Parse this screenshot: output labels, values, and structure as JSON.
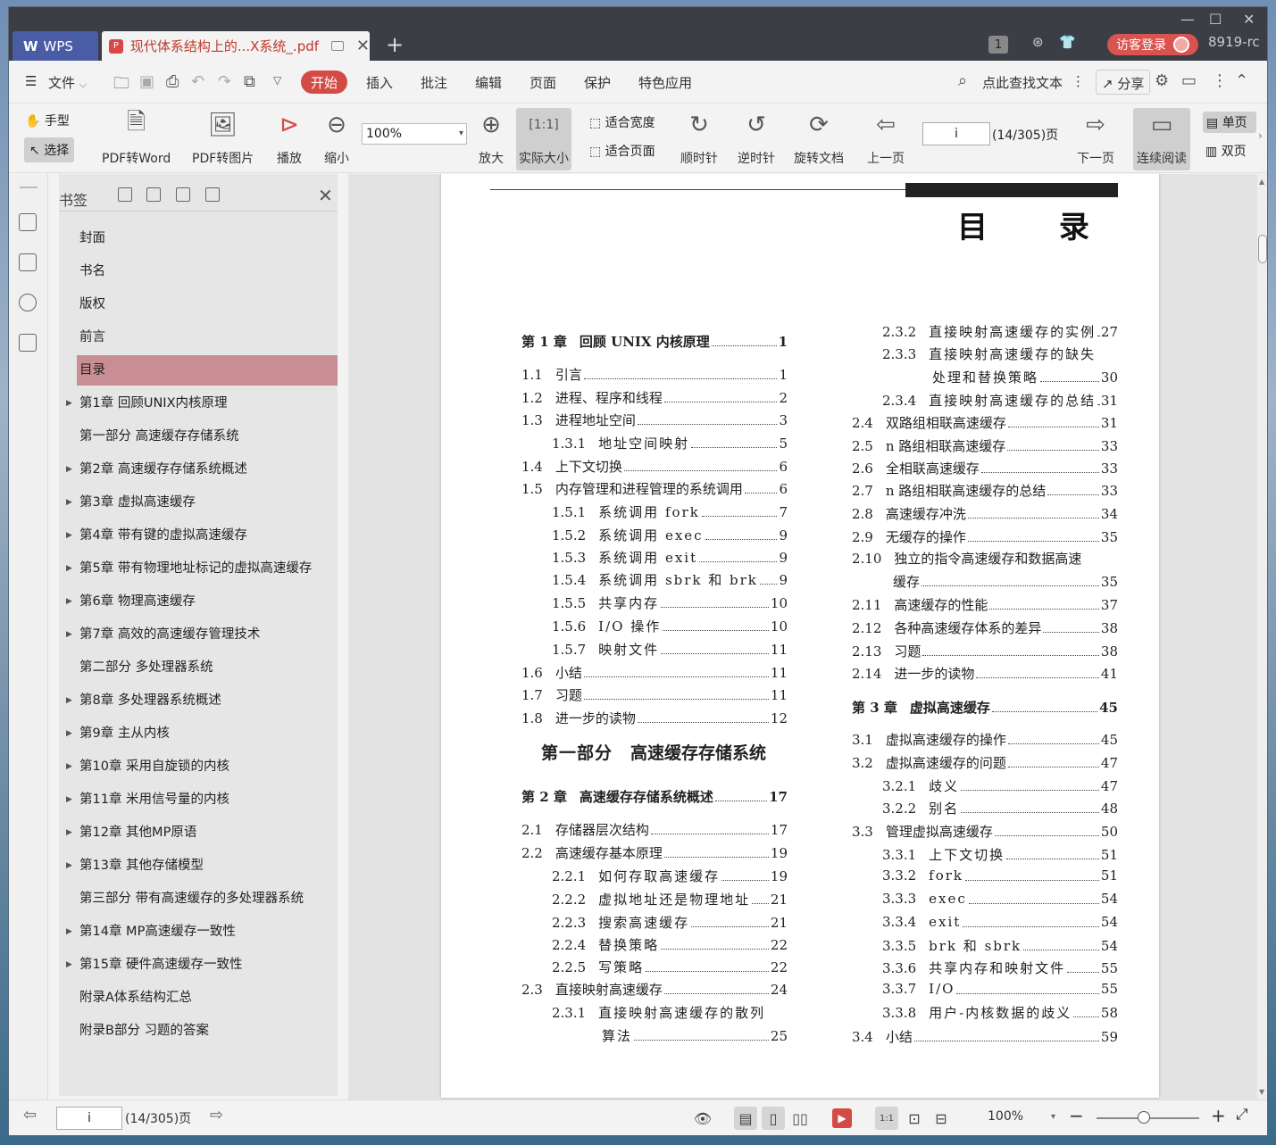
{
  "titlebar": {
    "app_tab": "WPS",
    "doc_tab": "现代体系结构上的...X系统_.pdf",
    "badge": "1",
    "login": "访客登录",
    "version": "8919-rc"
  },
  "menubar": {
    "file": "文件",
    "tabs": [
      "开始",
      "插入",
      "批注",
      "编辑",
      "页面",
      "保护",
      "特色应用"
    ],
    "search": "点此查找文本",
    "share": "分享"
  },
  "toolbar": {
    "hand": "手型",
    "select": "选择",
    "pdf2word": "PDF转Word",
    "pdf2img": "PDF转图片",
    "play": "播放",
    "zoom_out": "缩小",
    "zoom_value": "100%",
    "zoom_in": "放大",
    "actual_size": "实际大小",
    "fit_width": "适合宽度",
    "fit_page": "适合页面",
    "cw": "顺时针",
    "ccw": "逆时针",
    "rotate": "旋转文档",
    "prev": "上一页",
    "page_input": "i",
    "page_count": "(14/305)页",
    "next": "下一页",
    "continuous": "连续阅读",
    "single": "单页",
    "double": "双页"
  },
  "bookmarks": {
    "title": "书签",
    "items": [
      {
        "label": "封面",
        "arrow": false
      },
      {
        "label": "书名",
        "arrow": false
      },
      {
        "label": "版权",
        "arrow": false
      },
      {
        "label": "前言",
        "arrow": false
      },
      {
        "label": "目录",
        "arrow": false,
        "active": true
      },
      {
        "label": "第1章 回顾UNIX内核原理",
        "arrow": true
      },
      {
        "label": "第一部分 高速缓存存储系统",
        "arrow": false
      },
      {
        "label": "第2章 高速缓存存储系统概述",
        "arrow": true
      },
      {
        "label": "第3章 虚拟高速缓存",
        "arrow": true
      },
      {
        "label": "第4章 带有键的虚拟高速缓存",
        "arrow": true
      },
      {
        "label": "第5章 带有物理地址标记的虚拟高速缓存",
        "arrow": true
      },
      {
        "label": "第6章 物理高速缓存",
        "arrow": true
      },
      {
        "label": "第7章 高效的高速缓存管理技术",
        "arrow": true
      },
      {
        "label": "第二部分 多处理器系统",
        "arrow": false
      },
      {
        "label": "第8章 多处理器系统概述",
        "arrow": true
      },
      {
        "label": "第9章 主从内核",
        "arrow": true
      },
      {
        "label": "第10章 采用自旋锁的内核",
        "arrow": true
      },
      {
        "label": "第11章 米用信号量的内核",
        "arrow": true
      },
      {
        "label": "第12章 其他MP原语",
        "arrow": true
      },
      {
        "label": "第13章 其他存储模型",
        "arrow": true
      },
      {
        "label": "第三部分 带有高速缓存的多处理器系统",
        "arrow": false
      },
      {
        "label": "第14章 MP高速缓存一致性",
        "arrow": true
      },
      {
        "label": "第15章 硬件高速缓存一致性",
        "arrow": true
      },
      {
        "label": "附录A体系结构汇总",
        "arrow": false
      },
      {
        "label": "附录B部分 习题的答案",
        "arrow": false
      }
    ]
  },
  "document": {
    "heading": "目 录",
    "left": [
      {
        "num": "第 1 章",
        "text": "回顾 UNIX 内核原理",
        "page": "1",
        "kind": "ch"
      },
      {
        "num": "1.1",
        "text": "引言",
        "page": "1",
        "kind": "s1"
      },
      {
        "num": "1.2",
        "text": "进程、程序和线程",
        "page": "2",
        "kind": "s1"
      },
      {
        "num": "1.3",
        "text": "进程地址空间",
        "page": "3",
        "kind": "s1"
      },
      {
        "num": "1.3.1",
        "text": "地址空间映射",
        "page": "5",
        "kind": "s2"
      },
      {
        "num": "1.4",
        "text": "上下文切换",
        "page": "6",
        "kind": "s1"
      },
      {
        "num": "1.5",
        "text": "内存管理和进程管理的系统调用",
        "page": "6",
        "kind": "s1"
      },
      {
        "num": "1.5.1",
        "text": "系统调用 fork",
        "page": "7",
        "kind": "s2"
      },
      {
        "num": "1.5.2",
        "text": "系统调用 exec",
        "page": "9",
        "kind": "s2"
      },
      {
        "num": "1.5.3",
        "text": "系统调用 exit",
        "page": "9",
        "kind": "s2"
      },
      {
        "num": "1.5.4",
        "text": "系统调用 sbrk 和 brk",
        "page": "9",
        "kind": "s2"
      },
      {
        "num": "1.5.5",
        "text": "共享内存",
        "page": "10",
        "kind": "s2"
      },
      {
        "num": "1.5.6",
        "text": "I/O 操作",
        "page": "10",
        "kind": "s2"
      },
      {
        "num": "1.5.7",
        "text": "映射文件",
        "page": "11",
        "kind": "s2"
      },
      {
        "num": "1.6",
        "text": "小结",
        "page": "11",
        "kind": "s1"
      },
      {
        "num": "1.7",
        "text": "习题",
        "page": "11",
        "kind": "s1"
      },
      {
        "num": "1.8",
        "text": "进一步的读物",
        "page": "12",
        "kind": "s1"
      },
      {
        "num": "第一部分",
        "text": "高速缓存存储系统",
        "page": "",
        "kind": "part"
      },
      {
        "num": "第 2 章",
        "text": "高速缓存存储系统概述",
        "page": "17",
        "kind": "ch"
      },
      {
        "num": "2.1",
        "text": "存储器层次结构",
        "page": "17",
        "kind": "s1"
      },
      {
        "num": "2.2",
        "text": "高速缓存基本原理",
        "page": "19",
        "kind": "s1"
      },
      {
        "num": "2.2.1",
        "text": "如何存取高速缓存",
        "page": "19",
        "kind": "s2"
      },
      {
        "num": "2.2.2",
        "text": "虚拟地址还是物理地址",
        "page": "21",
        "kind": "s2"
      },
      {
        "num": "2.2.3",
        "text": "搜索高速缓存",
        "page": "21",
        "kind": "s2"
      },
      {
        "num": "2.2.4",
        "text": "替换策略",
        "page": "22",
        "kind": "s2"
      },
      {
        "num": "2.2.5",
        "text": "写策略",
        "page": "22",
        "kind": "s2"
      },
      {
        "num": "2.3",
        "text": "直接映射高速缓存",
        "page": "24",
        "kind": "s1"
      },
      {
        "num": "2.3.1",
        "text": "直接映射高速缓存的散列",
        "page": "",
        "kind": "s2"
      },
      {
        "num": "",
        "text": "算法",
        "page": "25",
        "kind": "cont"
      }
    ],
    "right": [
      {
        "num": "2.3.2",
        "text": "直接映射高速缓存的实例",
        "page": "27",
        "kind": "s2"
      },
      {
        "num": "2.3.3",
        "text": "直接映射高速缓存的缺失",
        "page": "",
        "kind": "s2"
      },
      {
        "num": "",
        "text": "处理和替换策略",
        "page": "30",
        "kind": "cont"
      },
      {
        "num": "2.3.4",
        "text": "直接映射高速缓存的总结",
        "page": "31",
        "kind": "s2"
      },
      {
        "num": "2.4",
        "text": "双路组相联高速缓存",
        "page": "31",
        "kind": "s1"
      },
      {
        "num": "2.5",
        "text": "n 路组相联高速缓存",
        "page": "33",
        "kind": "s1"
      },
      {
        "num": "2.6",
        "text": "全相联高速缓存",
        "page": "33",
        "kind": "s1"
      },
      {
        "num": "2.7",
        "text": "n 路组相联高速缓存的总结",
        "page": "33",
        "kind": "s1"
      },
      {
        "num": "2.8",
        "text": "高速缓存冲洗",
        "page": "34",
        "kind": "s1"
      },
      {
        "num": "2.9",
        "text": "无缓存的操作",
        "page": "35",
        "kind": "s1"
      },
      {
        "num": "2.10",
        "text": "独立的指令高速缓存和数据高速",
        "page": "",
        "kind": "s1"
      },
      {
        "num": "",
        "text": "缓存",
        "page": "35",
        "kind": "cont1"
      },
      {
        "num": "2.11",
        "text": "高速缓存的性能",
        "page": "37",
        "kind": "s1"
      },
      {
        "num": "2.12",
        "text": "各种高速缓存体系的差异",
        "page": "38",
        "kind": "s1"
      },
      {
        "num": "2.13",
        "text": "习题",
        "page": "38",
        "kind": "s1"
      },
      {
        "num": "2.14",
        "text": "进一步的读物",
        "page": "41",
        "kind": "s1"
      },
      {
        "num": "第 3 章",
        "text": "虚拟高速缓存",
        "page": "45",
        "kind": "ch"
      },
      {
        "num": "3.1",
        "text": "虚拟高速缓存的操作",
        "page": "45",
        "kind": "s1"
      },
      {
        "num": "3.2",
        "text": "虚拟高速缓存的问题",
        "page": "47",
        "kind": "s1"
      },
      {
        "num": "3.2.1",
        "text": "歧义",
        "page": "47",
        "kind": "s2"
      },
      {
        "num": "3.2.2",
        "text": "别名",
        "page": "48",
        "kind": "s2"
      },
      {
        "num": "3.3",
        "text": "管理虚拟高速缓存",
        "page": "50",
        "kind": "s1"
      },
      {
        "num": "3.3.1",
        "text": "上下文切换",
        "page": "51",
        "kind": "s2"
      },
      {
        "num": "3.3.2",
        "text": "fork",
        "page": "51",
        "kind": "s2"
      },
      {
        "num": "3.3.3",
        "text": "exec",
        "page": "54",
        "kind": "s2"
      },
      {
        "num": "3.3.4",
        "text": "exit",
        "page": "54",
        "kind": "s2"
      },
      {
        "num": "3.3.5",
        "text": "brk 和 sbrk",
        "page": "54",
        "kind": "s2"
      },
      {
        "num": "3.3.6",
        "text": "共享内存和映射文件",
        "page": "55",
        "kind": "s2"
      },
      {
        "num": "3.3.7",
        "text": "I/O",
        "page": "55",
        "kind": "s2"
      },
      {
        "num": "3.3.8",
        "text": "用户-内核数据的歧义",
        "page": "58",
        "kind": "s2"
      },
      {
        "num": "3.4",
        "text": "小结",
        "page": "59",
        "kind": "s1"
      }
    ]
  },
  "statusbar": {
    "page_input": "i",
    "page_count": "(14/305)页",
    "zoom": "100%"
  }
}
